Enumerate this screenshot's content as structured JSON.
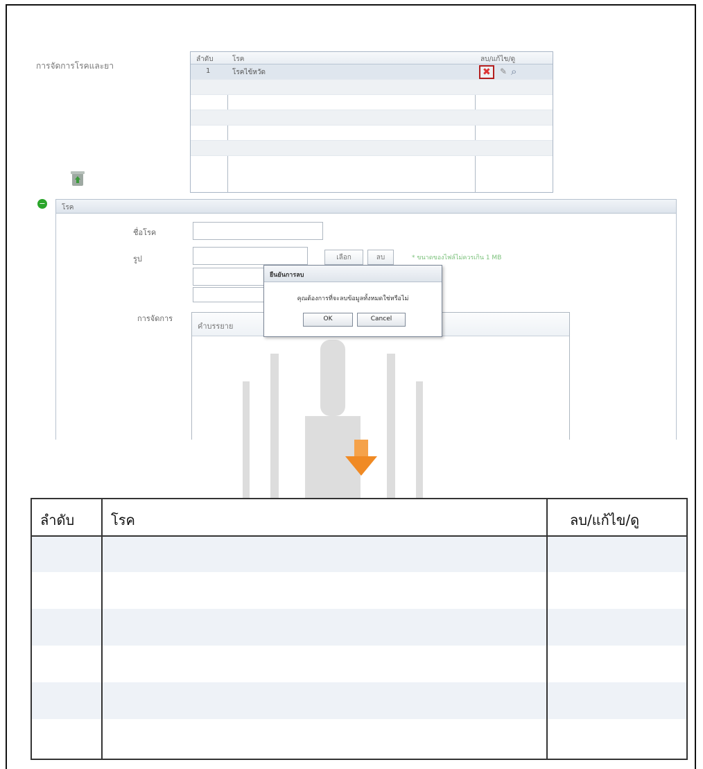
{
  "screenshot": {
    "menu_title": "การจัดการโรคและยา",
    "grid": {
      "columns": [
        "ลำดับ",
        "โรค",
        "ลบ/แก้ไข/ดู"
      ],
      "rows": [
        {
          "no": "1",
          "disease": "โรคไข้หวัด"
        }
      ]
    },
    "panel_title": "โรค",
    "form": {
      "label_name": "ชื่อโรค",
      "label_image": "รูป",
      "browse_button": "เลือก",
      "delete_button": "ลบ",
      "file_note": "* ขนาดของไฟล์ไม่ควรเกิน 1 MB",
      "label_treatment": "การจัดการ",
      "description_header": "คำบรรยาย"
    },
    "dialog": {
      "title": "ยืนยันการลบ",
      "message": "คุณต้องการที่จะลบข้อมูลทั้งหมดใช่หรือไม่",
      "ok": "OK",
      "cancel": "Cancel"
    }
  },
  "enlarged_table": {
    "columns": [
      "ลำดับ",
      "โรค",
      "ลบ/แก้ไข/ดู"
    ]
  },
  "icons": [
    "delete-icon",
    "edit-pencil-icon",
    "view-magnifier-icon",
    "recycle-bin-icon",
    "collapse-icon",
    "arrow-down-icon"
  ],
  "colors": {
    "delete_highlight": "#b31e1e",
    "arrow": "#f08a24",
    "note_green": "#7bc17b"
  }
}
